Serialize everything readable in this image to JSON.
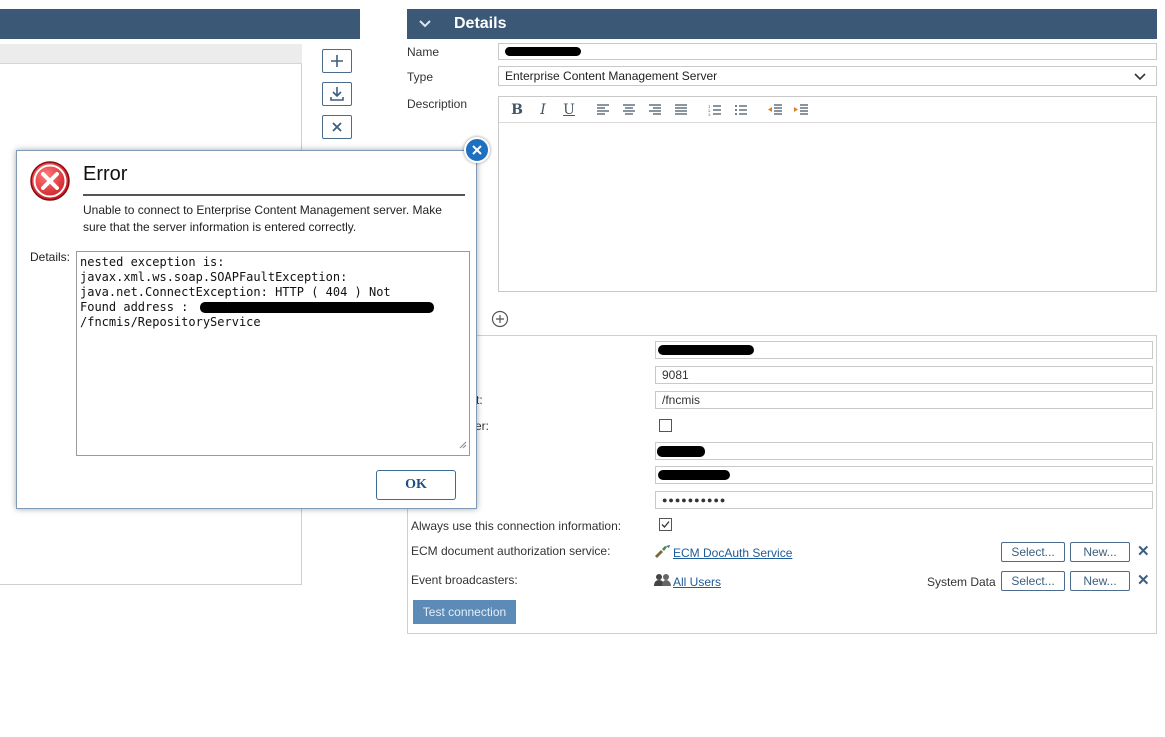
{
  "details_panel": {
    "header_title": "Details",
    "name_label": "Name",
    "type_label": "Type",
    "type_value": "Enterprise Content Management Server",
    "description_label": "Description"
  },
  "connection": {
    "port_value": "9081",
    "context_label_fragment": "t:",
    "context_value": "/fncmis",
    "ssl_label_fragment": "er:",
    "password_mask": "●●●●●●●●●●",
    "always_use_label": "Always use this connection information:",
    "docauth_label": "ECM document authorization service:",
    "docauth_link": "ECM DocAuth Service",
    "event_label": "Event broadcasters:",
    "event_link": "All Users",
    "event_extra": "System Data",
    "select_label": "Select...",
    "new_label": "New...",
    "test_button": "Test connection"
  },
  "dialog": {
    "title": "Error",
    "message": "Unable to connect to Enterprise Content Management server. Make sure that the server information is entered correctly.",
    "details_label": "Details:",
    "details_lines": [
      "nested exception is:",
      "javax.xml.ws.soap.SOAPFaultException:",
      "java.net.ConnectException: HTTP ( 404 ) Not",
      "Found address :",
      "/fncmis/RepositoryService"
    ],
    "ok_label": "OK"
  },
  "colors": {
    "header_blue": "#3b5877",
    "accent_blue": "#1e70c0",
    "link_blue": "#1d5b99",
    "error_red": "#d9262c"
  }
}
